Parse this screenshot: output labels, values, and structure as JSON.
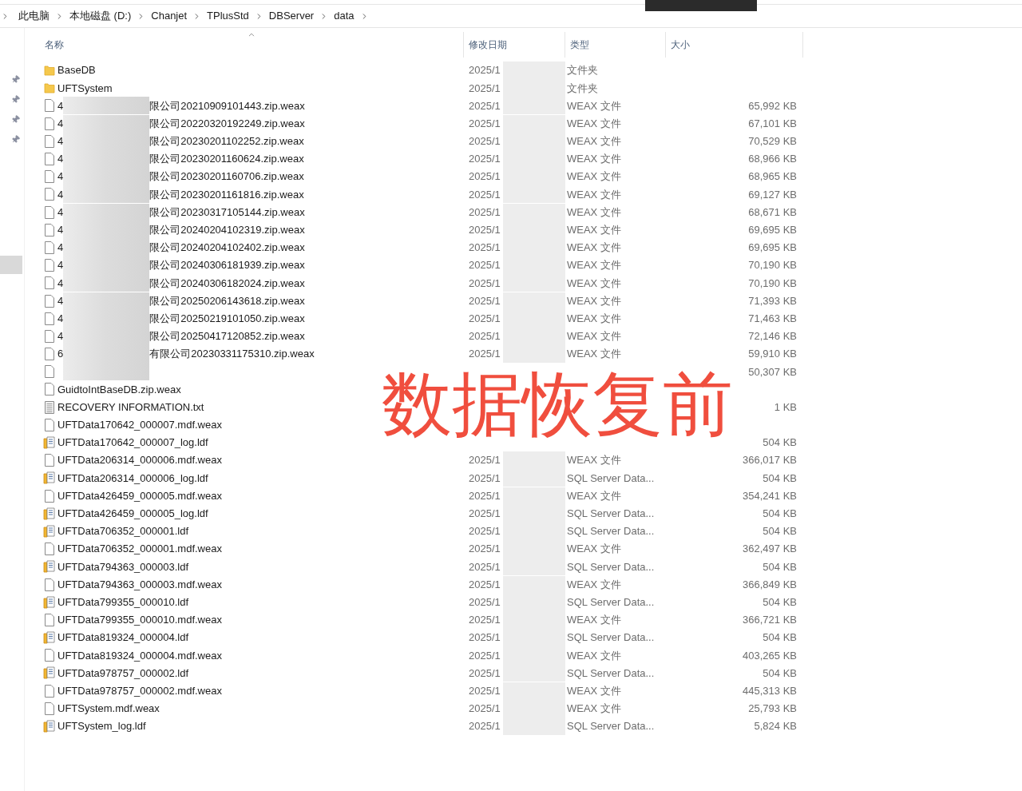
{
  "breadcrumb": [
    "此电脑",
    "本地磁盘 (D:)",
    "Chanjet",
    "TPlusStd",
    "DBServer",
    "data"
  ],
  "columns": [
    {
      "label": "名称",
      "sorted": true
    },
    {
      "label": "修改日期",
      "sorted": false
    },
    {
      "label": "类型",
      "sorted": false
    },
    {
      "label": "大小",
      "sorted": false
    }
  ],
  "files": [
    {
      "kind": "folder",
      "name": "BaseDB",
      "date": "2025/1",
      "type": "文件夹"
    },
    {
      "kind": "folder",
      "name": "UFTSystem",
      "date": "2025/1",
      "type": "文件夹"
    },
    {
      "kind": "file",
      "redacted": true,
      "name_prefix": "4",
      "name": "限公司20210909101443.zip.weax",
      "date": "2025/1",
      "type": "WEAX 文件",
      "size": "65,992 KB"
    },
    {
      "kind": "file",
      "redacted": true,
      "name_prefix": "4",
      "name": "限公司20220320192249.zip.weax",
      "date": "2025/1",
      "type": "WEAX 文件",
      "size": "67,101 KB"
    },
    {
      "kind": "file",
      "redacted": true,
      "name_prefix": "4",
      "name": "限公司20230201102252.zip.weax",
      "date": "2025/1",
      "type": "WEAX 文件",
      "size": "70,529 KB"
    },
    {
      "kind": "file",
      "redacted": true,
      "name_prefix": "4",
      "name": "限公司20230201160624.zip.weax",
      "date": "2025/1",
      "type": "WEAX 文件",
      "size": "68,966 KB"
    },
    {
      "kind": "file",
      "redacted": true,
      "name_prefix": "4",
      "name": "限公司20230201160706.zip.weax",
      "date": "2025/1",
      "type": "WEAX 文件",
      "size": "68,965 KB"
    },
    {
      "kind": "file",
      "redacted": true,
      "name_prefix": "4",
      "name": "限公司20230201161816.zip.weax",
      "date": "2025/1",
      "type": "WEAX 文件",
      "size": "69,127 KB"
    },
    {
      "kind": "file",
      "redacted": true,
      "name_prefix": "4",
      "name": "限公司20230317105144.zip.weax",
      "date": "2025/1",
      "type": "WEAX 文件",
      "size": "68,671 KB"
    },
    {
      "kind": "file",
      "redacted": true,
      "name_prefix": "4",
      "name": "限公司20240204102319.zip.weax",
      "date": "2025/1",
      "type": "WEAX 文件",
      "size": "69,695 KB"
    },
    {
      "kind": "file",
      "redacted": true,
      "name_prefix": "4",
      "name": "限公司20240204102402.zip.weax",
      "date": "2025/1",
      "type": "WEAX 文件",
      "size": "69,695 KB"
    },
    {
      "kind": "file",
      "redacted": true,
      "name_prefix": "4",
      "name": "限公司20240306181939.zip.weax",
      "date": "2025/1",
      "type": "WEAX 文件",
      "size": "70,190 KB"
    },
    {
      "kind": "file",
      "redacted": true,
      "name_prefix": "4",
      "name": "限公司20240306182024.zip.weax",
      "date": "2025/1",
      "type": "WEAX 文件",
      "size": "70,190 KB"
    },
    {
      "kind": "file",
      "redacted": true,
      "name_prefix": "4",
      "name": "限公司20250206143618.zip.weax",
      "date": "2025/1",
      "type": "WEAX 文件",
      "size": "71,393 KB"
    },
    {
      "kind": "file",
      "redacted": true,
      "name_prefix": "4",
      "name": "限公司20250219101050.zip.weax",
      "date": "2025/1",
      "type": "WEAX 文件",
      "size": "71,463 KB"
    },
    {
      "kind": "file",
      "redacted": true,
      "name_prefix": "4",
      "name": "限公司20250417120852.zip.weax",
      "date": "2025/1",
      "type": "WEAX 文件",
      "size": "72,146 KB"
    },
    {
      "kind": "file",
      "redacted": true,
      "name_prefix": "6",
      "name": "有限公司20230331175310.zip.weax",
      "date": "2025/1",
      "type": "WEAX 文件",
      "size": "59,910 KB"
    },
    {
      "kind": "file",
      "redacted": true,
      "size": "50,307 KB"
    },
    {
      "kind": "file",
      "name": "GuidtoIntBaseDB.zip.weax"
    },
    {
      "kind": "text",
      "name": "RECOVERY INFORMATION.txt",
      "size": "1 KB"
    },
    {
      "kind": "file",
      "name": "UFTData170642_000007.mdf.weax"
    },
    {
      "kind": "ldf",
      "name": "UFTData170642_000007_log.ldf",
      "size": "504 KB"
    },
    {
      "kind": "file",
      "name": "UFTData206314_000006.mdf.weax",
      "date": "2025/1",
      "type": "WEAX 文件",
      "size": "366,017 KB"
    },
    {
      "kind": "ldf",
      "name": "UFTData206314_000006_log.ldf",
      "date": "2025/1",
      "type": "SQL Server Data...",
      "size": "504 KB"
    },
    {
      "kind": "file",
      "name": "UFTData426459_000005.mdf.weax",
      "date": "2025/1",
      "type": "WEAX 文件",
      "size": "354,241 KB"
    },
    {
      "kind": "ldf",
      "name": "UFTData426459_000005_log.ldf",
      "date": "2025/1",
      "type": "SQL Server Data...",
      "size": "504 KB"
    },
    {
      "kind": "ldf",
      "name": "UFTData706352_000001.ldf",
      "date": "2025/1",
      "type": "SQL Server Data...",
      "size": "504 KB"
    },
    {
      "kind": "file",
      "name": "UFTData706352_000001.mdf.weax",
      "date": "2025/1",
      "type": "WEAX 文件",
      "size": "362,497 KB"
    },
    {
      "kind": "ldf",
      "name": "UFTData794363_000003.ldf",
      "date": "2025/1",
      "type": "SQL Server Data...",
      "size": "504 KB"
    },
    {
      "kind": "file",
      "name": "UFTData794363_000003.mdf.weax",
      "date": "2025/1",
      "type": "WEAX 文件",
      "size": "366,849 KB"
    },
    {
      "kind": "ldf",
      "name": "UFTData799355_000010.ldf",
      "date": "2025/1",
      "type": "SQL Server Data...",
      "size": "504 KB"
    },
    {
      "kind": "file",
      "name": "UFTData799355_000010.mdf.weax",
      "date": "2025/1",
      "type": "WEAX 文件",
      "size": "366,721 KB"
    },
    {
      "kind": "ldf",
      "name": "UFTData819324_000004.ldf",
      "date": "2025/1",
      "type": "SQL Server Data...",
      "size": "504 KB"
    },
    {
      "kind": "file",
      "name": "UFTData819324_000004.mdf.weax",
      "date": "2025/1",
      "type": "WEAX 文件",
      "size": "403,265 KB"
    },
    {
      "kind": "ldf",
      "name": "UFTData978757_000002.ldf",
      "date": "2025/1",
      "type": "SQL Server Data...",
      "size": "504 KB"
    },
    {
      "kind": "file",
      "name": "UFTData978757_000002.mdf.weax",
      "date": "2025/1",
      "type": "WEAX 文件",
      "size": "445,313 KB"
    },
    {
      "kind": "file",
      "name": "UFTSystem.mdf.weax",
      "date": "2025/1",
      "type": "WEAX 文件",
      "size": "25,793 KB"
    },
    {
      "kind": "ldf",
      "name": "UFTSystem_log.ldf",
      "date": "2025/1",
      "type": "SQL Server Data...",
      "size": "5,824 KB"
    }
  ],
  "overlay_caption": "数据恢复前"
}
